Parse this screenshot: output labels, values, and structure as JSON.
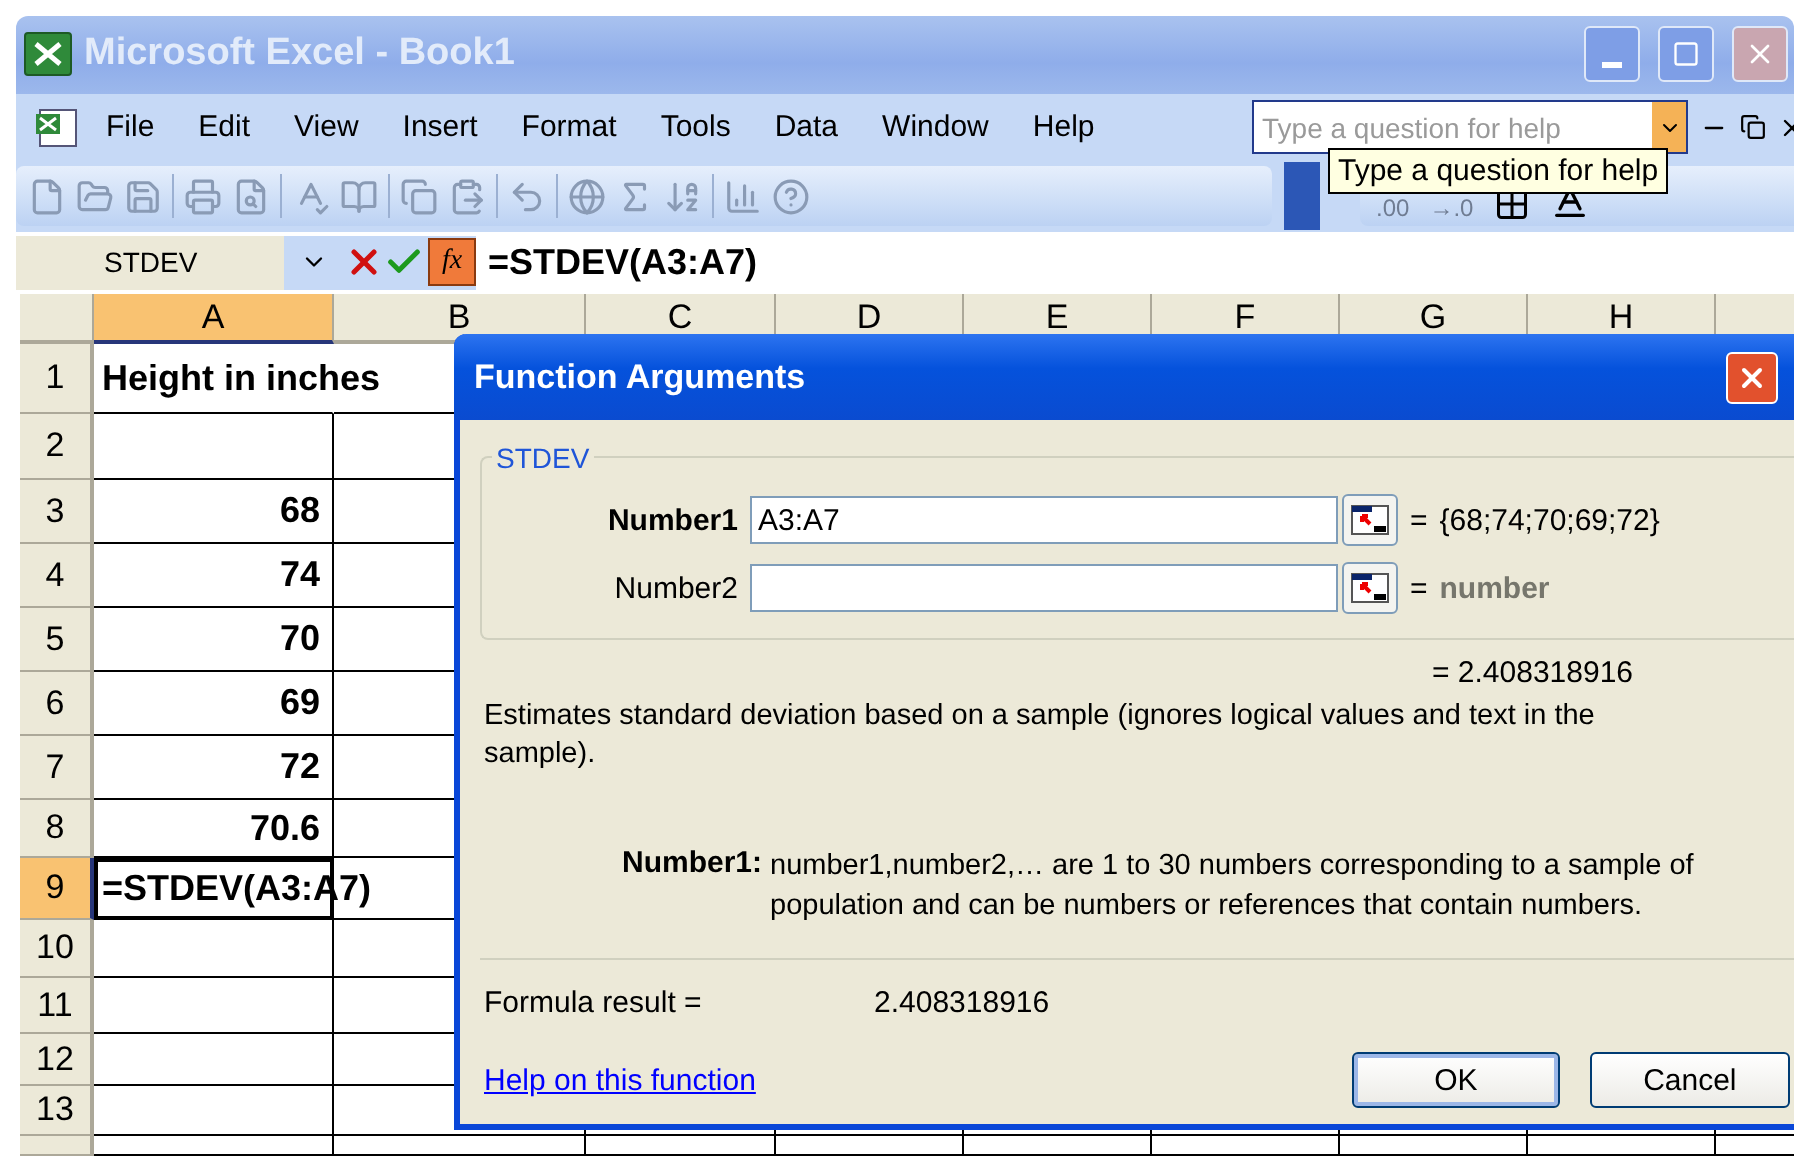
{
  "window": {
    "title": "Microsoft Excel - Book1"
  },
  "menu": [
    "File",
    "Edit",
    "View",
    "Insert",
    "Format",
    "Tools",
    "Data",
    "Window",
    "Help"
  ],
  "help_box": {
    "placeholder": "Type a question for help"
  },
  "tooltip": "Type a question for help",
  "toolbar": {
    "decimal_buttons": [
      ".00",
      "→.0"
    ]
  },
  "formula_bar": {
    "name_box": "STDEV",
    "fx_label": "fx",
    "formula": "=STDEV(A3:A7)"
  },
  "sheet": {
    "columns": [
      {
        "label": "A",
        "selected": true
      },
      {
        "label": "B",
        "selected": false
      },
      {
        "label": "C",
        "selected": false
      },
      {
        "label": "D",
        "selected": false
      },
      {
        "label": "E",
        "selected": false
      },
      {
        "label": "F",
        "selected": false
      },
      {
        "label": "G",
        "selected": false
      },
      {
        "label": "H",
        "selected": false
      }
    ],
    "rows": [
      {
        "label": "1",
        "selected": false,
        "kind": "text",
        "value": "Height in inches"
      },
      {
        "label": "2",
        "selected": false,
        "kind": "empty"
      },
      {
        "label": "3",
        "selected": false,
        "kind": "number",
        "value": "68"
      },
      {
        "label": "4",
        "selected": false,
        "kind": "number",
        "value": "74"
      },
      {
        "label": "5",
        "selected": false,
        "kind": "number",
        "value": "70"
      },
      {
        "label": "6",
        "selected": false,
        "kind": "number",
        "value": "69"
      },
      {
        "label": "7",
        "selected": false,
        "kind": "number",
        "value": "72"
      },
      {
        "label": "8",
        "selected": false,
        "kind": "number",
        "value": "70.6"
      },
      {
        "label": "9",
        "selected": true,
        "kind": "formula",
        "value": "=STDEV(A3:A7)"
      },
      {
        "label": "10",
        "selected": false,
        "kind": "empty"
      },
      {
        "label": "11",
        "selected": false,
        "kind": "empty"
      },
      {
        "label": "12",
        "selected": false,
        "kind": "empty"
      },
      {
        "label": "13",
        "selected": false,
        "kind": "empty"
      }
    ]
  },
  "dialog": {
    "title": "Function Arguments",
    "function": "STDEV",
    "args": [
      {
        "label": "Number1",
        "required": true,
        "value": "A3:A7",
        "equals": "=",
        "result": "{68;74;70;69;72}",
        "hint": false
      },
      {
        "label": "Number2",
        "required": false,
        "equals": "=",
        "result": "number",
        "hint": true
      }
    ],
    "value_line": "= 2.408318916",
    "description": "Estimates standard deviation based on a sample (ignores logical values and text in the sample).",
    "arg_help": {
      "label": "Number1:",
      "lines": [
        "number1,number2,… are 1 to 30 numbers corresponding to a sample of",
        "population and can be numbers or references that contain numbers."
      ]
    },
    "formula_result": {
      "label": "Formula result =",
      "value": "2.408318916"
    },
    "help_link": "Help on this function",
    "buttons": [
      {
        "label": "OK",
        "default": true
      },
      {
        "label": "Cancel",
        "default": false
      }
    ]
  }
}
